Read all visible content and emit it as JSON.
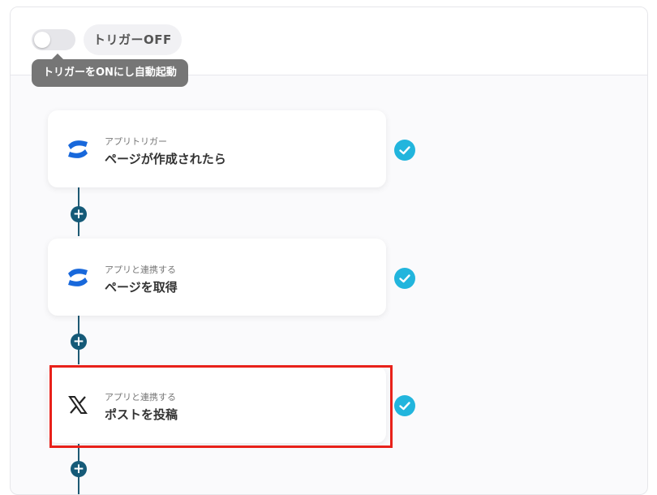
{
  "header": {
    "toggle_state_label": "トリガーOFF",
    "tooltip": "トリガーをONにし自動起動"
  },
  "steps": [
    {
      "subtitle": "アプリトリガー",
      "title": "ページが作成されたら",
      "app_icon": "confluence-icon",
      "status": "complete"
    },
    {
      "subtitle": "アプリと連携する",
      "title": "ページを取得",
      "app_icon": "confluence-icon",
      "status": "complete"
    },
    {
      "subtitle": "アプリと連携する",
      "title": "ポストを投稿",
      "app_icon": "x-logo-icon",
      "status": "complete",
      "highlighted": true
    }
  ],
  "colors": {
    "confluence_blue": "#1868db",
    "check_blue": "#22b5dd",
    "connector": "#1f5a74",
    "highlight_red": "#e8211a"
  }
}
